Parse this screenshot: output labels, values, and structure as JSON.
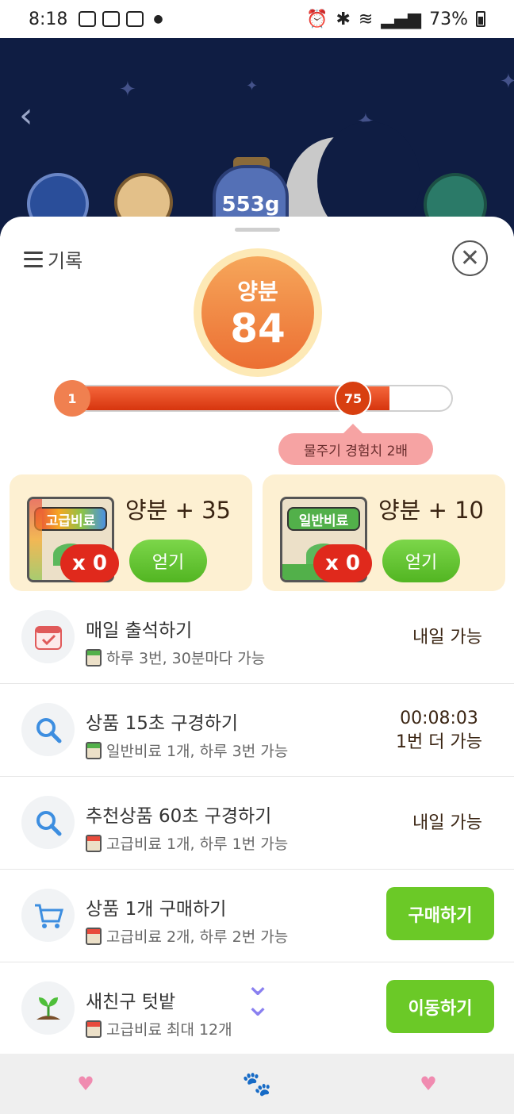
{
  "status_bar": {
    "time": "8:18",
    "battery": "73%"
  },
  "scene": {
    "jar_label": "553g"
  },
  "sheet": {
    "log_label": "기록",
    "nutrient": {
      "label": "양분",
      "value": "84"
    },
    "progress": {
      "start_label": "1",
      "marker_label": "75",
      "fill_fraction": 0.84,
      "tooltip": "물주기 경험치 2배"
    },
    "fertilizers": [
      {
        "bag_label": "고급비료",
        "count": "x 0",
        "gain": "양분 + 35",
        "button": "얻기"
      },
      {
        "bag_label": "일반비료",
        "count": "x 0",
        "gain": "양분 + 10",
        "button": "얻기"
      }
    ],
    "tasks": [
      {
        "title": "매일 출석하기",
        "sub": "하루 3번, 30분마다 가능",
        "status_line1": "내일 가능",
        "status_line2": ""
      },
      {
        "title": "상품 15초 구경하기",
        "sub": "일반비료 1개, 하루 3번 가능",
        "status_line1": "00:08:03",
        "status_line2": "1번 더 가능"
      },
      {
        "title": "추천상품 60초 구경하기",
        "sub": "고급비료 1개, 하루 1번 가능",
        "status_line1": "내일 가능",
        "status_line2": ""
      },
      {
        "title": "상품 1개 구매하기",
        "sub": "고급비료 2개, 하루 2번 가능",
        "action": "구매하기"
      },
      {
        "title": "새친구 텃밭",
        "sub": "고급비료 최대 12개",
        "action": "이동하기"
      }
    ]
  },
  "icons": {
    "back": "chevron-left-icon",
    "menu": "hamburger-menu-icon",
    "close": "close-circle-icon",
    "calendar": "calendar-icon",
    "search": "search-icon",
    "cart": "cart-icon",
    "sprout": "sprout-icon",
    "scroll": "double-chevron-down-icon",
    "tab_left": "heart-icon",
    "tab_center": "paw-icon",
    "tab_right": "heart-icon"
  },
  "colors": {
    "accent_orange": "#ec6f33",
    "green": "#6bc927",
    "progress_red": "#d7350e",
    "scene_bg": "#0f1d43"
  }
}
